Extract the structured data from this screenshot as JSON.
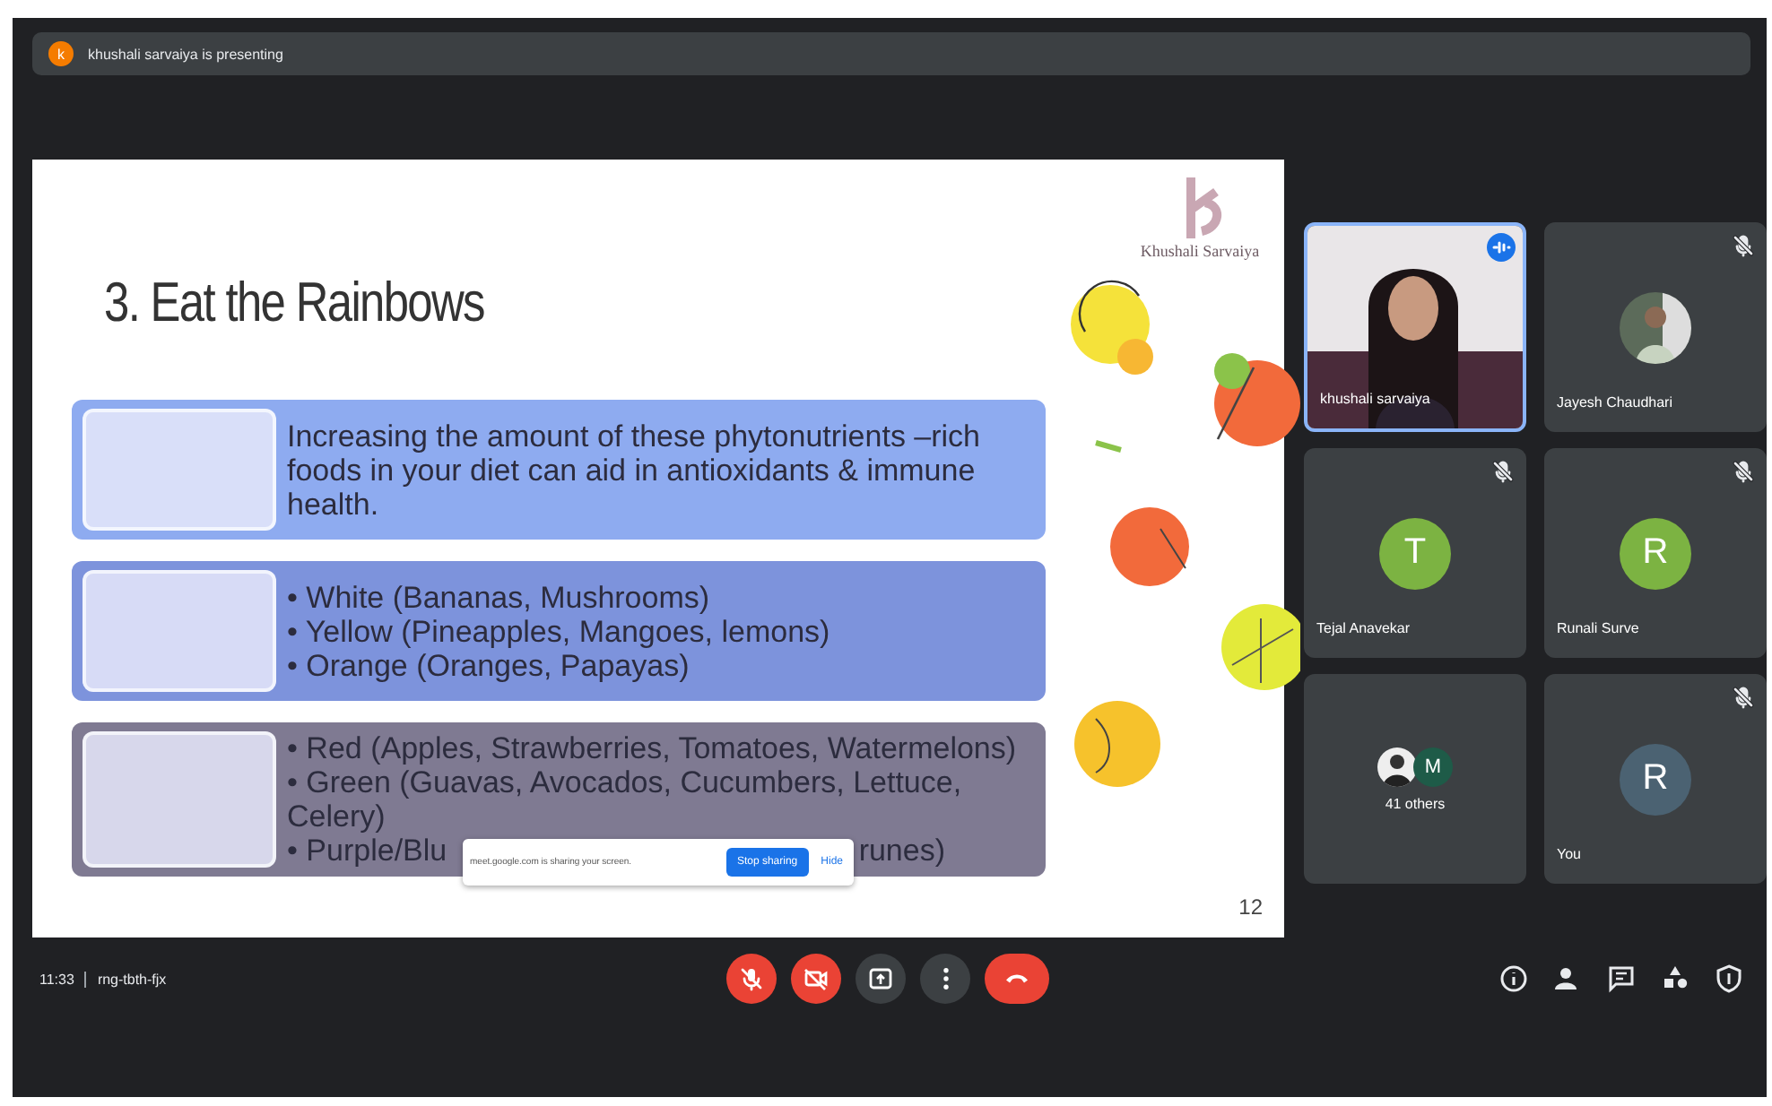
{
  "presenting_bar": {
    "avatar_letter": "k",
    "text": "khushali sarvaiya is presenting"
  },
  "slide": {
    "title": "3. Eat the Rainbows",
    "logo_text": "Khushali Sarvaiya",
    "page_number": "12",
    "boxes": [
      {
        "color": "#8eabf0",
        "lines": [
          {
            "text": "Increasing the amount of these phytonutrients –rich foods in your diet can aid in antioxidants & immune health."
          }
        ]
      },
      {
        "color": "#7d93dc",
        "lines": [
          {
            "text": "• White (Bananas, Mushrooms)"
          },
          {
            "text": "• Yellow (Pineapples, Mangoes, lemons)"
          },
          {
            "text": "• Orange (Oranges, Papayas)"
          }
        ]
      },
      {
        "color": "#7f7a92",
        "lines": [
          {
            "text": "• Red (Apples, Strawberries, Tomatoes, Watermelons)"
          },
          {
            "text": "• Green (Guavas, Avocados, Cucumbers, Lettuce, Celery)"
          },
          {
            "parts": [
              "• Purple/Blu",
              "runes)"
            ]
          }
        ]
      }
    ],
    "share_notice": {
      "text": "meet.google.com is sharing your screen.",
      "stop_button": "Stop sharing",
      "hide_button": "Hide"
    }
  },
  "tiles": [
    {
      "kind": "video",
      "name": "khushali sarvaiya",
      "speaking": true,
      "muted": false
    },
    {
      "name": "Jayesh Chaudhari",
      "speaking": false,
      "muted": true
    },
    {
      "kind": "letter",
      "letter": "T",
      "color": "#7cb342",
      "name": "Tejal Anavekar",
      "speaking": false,
      "muted": true
    },
    {
      "kind": "letter",
      "letter": "R",
      "color": "#7cb342",
      "name": "Runali Surve",
      "speaking": false,
      "muted": true
    },
    {
      "kind": "others",
      "letter": "M",
      "color": "#1e5b48",
      "label": "41 others",
      "speaking": false,
      "muted": false
    },
    {
      "kind": "letter",
      "letter": "R",
      "color": "#4b6272",
      "name": "You",
      "speaking": false,
      "muted": true
    }
  ],
  "bottom_bar": {
    "time": "11:33",
    "meeting_code": "rng-tbth-fjx",
    "controls": [
      {
        "kind": "mic",
        "off": true
      },
      {
        "kind": "camera",
        "off": true
      },
      {
        "kind": "present"
      },
      {
        "kind": "more"
      },
      {
        "kind": "hangup"
      }
    ],
    "right_icons": [
      {
        "kind": "info"
      },
      {
        "kind": "people"
      },
      {
        "kind": "chat"
      },
      {
        "kind": "activities"
      },
      {
        "kind": "safety"
      }
    ]
  }
}
